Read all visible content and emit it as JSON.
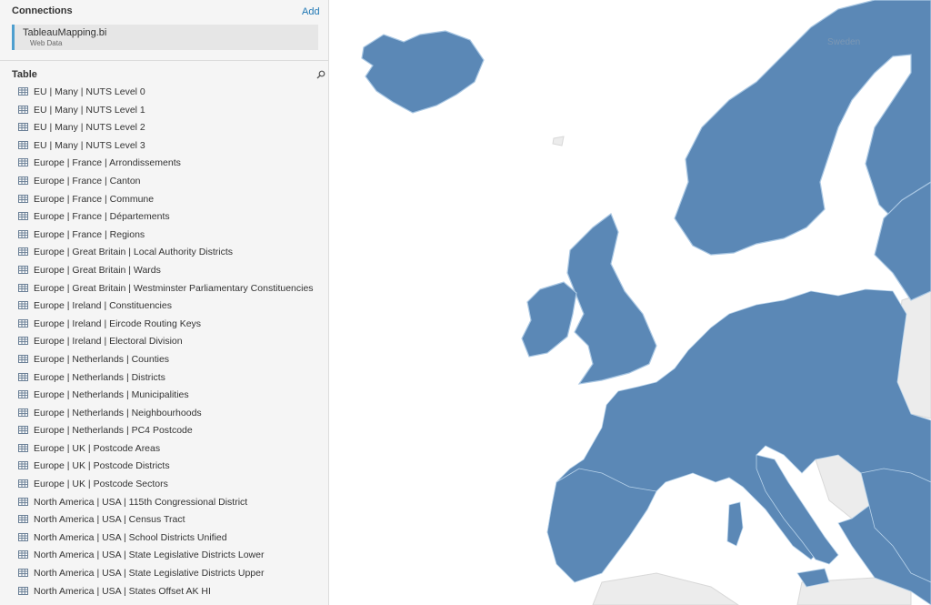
{
  "connections": {
    "title": "Connections",
    "add_label": "Add",
    "source": {
      "name": "TableauMapping.bi",
      "type": "Web Data"
    }
  },
  "table_section": {
    "title": "Table",
    "search_icon": "search-icon",
    "items": [
      "EU | Many | NUTS Level 0",
      "EU | Many | NUTS Level 1",
      "EU | Many | NUTS Level 2",
      "EU | Many | NUTS Level 3",
      "Europe | France | Arrondissements",
      "Europe | France | Canton",
      "Europe | France | Commune",
      "Europe | France | Départements",
      "Europe | France | Regions",
      "Europe | Great Britain | Local Authority Districts",
      "Europe | Great Britain | Wards",
      "Europe | Great Britain | Westminster Parliamentary Constituencies",
      "Europe | Ireland | Constituencies",
      "Europe | Ireland | Eircode Routing Keys",
      "Europe | Ireland | Electoral Division",
      "Europe | Netherlands | Counties",
      "Europe | Netherlands | Districts",
      "Europe | Netherlands | Municipalities",
      "Europe | Netherlands | Neighbourhoods",
      "Europe | Netherlands | PC4 Postcode",
      "Europe | UK | Postcode Areas",
      "Europe | UK | Postcode Districts",
      "Europe | UK | Postcode Sectors",
      "North America | USA | 115th Congressional District",
      "North America | USA | Census Tract",
      "North America | USA | School Districts Unified",
      "North America | USA | State Legislative Districts Lower",
      "North America | USA | State Legislative Districts Upper",
      "North America | USA | States Offset AK HI"
    ]
  },
  "map": {
    "labels": {
      "sweden": "Sweden"
    },
    "colors": {
      "region_fill": "#5b88b6",
      "region_border": "#a9c7e3",
      "unmapped": "#ececec",
      "background": "#ffffff"
    }
  }
}
